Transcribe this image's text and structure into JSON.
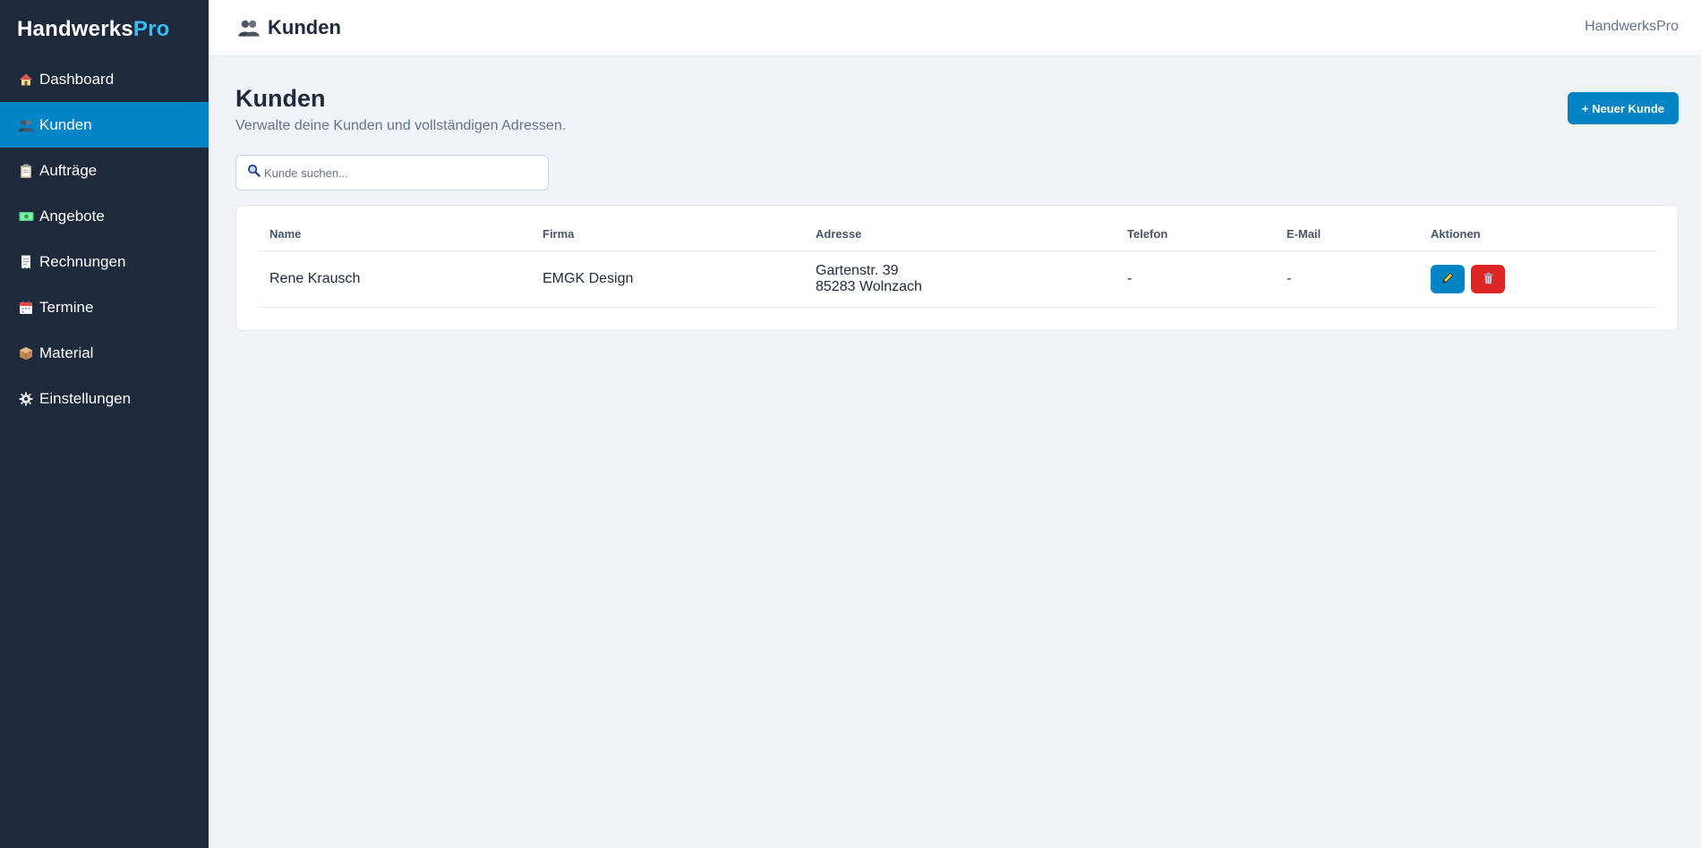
{
  "brand": {
    "name_main": "Handwerks",
    "name_accent": "Pro"
  },
  "colors": {
    "sidebar_bg": "#1e293b",
    "accent": "#0284c7",
    "brand_accent": "#38bdf8",
    "danger": "#dc2626"
  },
  "sidebar": {
    "items": [
      {
        "label": "Dashboard",
        "icon": "house-icon"
      },
      {
        "label": "Kunden",
        "icon": "people-icon",
        "active": true
      },
      {
        "label": "Aufträge",
        "icon": "clipboard-icon"
      },
      {
        "label": "Angebote",
        "icon": "money-icon"
      },
      {
        "label": "Rechnungen",
        "icon": "receipt-icon"
      },
      {
        "label": "Termine",
        "icon": "calendar-icon"
      },
      {
        "label": "Material",
        "icon": "package-icon"
      },
      {
        "label": "Einstellungen",
        "icon": "gear-icon"
      }
    ]
  },
  "topbar": {
    "title": "Kunden",
    "title_icon": "people-icon",
    "brand": "HandwerksPro"
  },
  "page": {
    "title": "Kunden",
    "subtitle": "Verwalte deine Kunden und vollständigen Adressen.",
    "new_button": "+ Neuer Kunde"
  },
  "search": {
    "placeholder": "Kunde suchen...",
    "value": ""
  },
  "table": {
    "columns": [
      "Name",
      "Firma",
      "Adresse",
      "Telefon",
      "E-Mail",
      "Aktionen"
    ],
    "rows": [
      {
        "name": "Rene Krausch",
        "firma": "EMGK Design",
        "address_line1": "Gartenstr. 39",
        "address_line2": "85283 Wolnzach",
        "telefon": "-",
        "email": "-"
      }
    ]
  }
}
